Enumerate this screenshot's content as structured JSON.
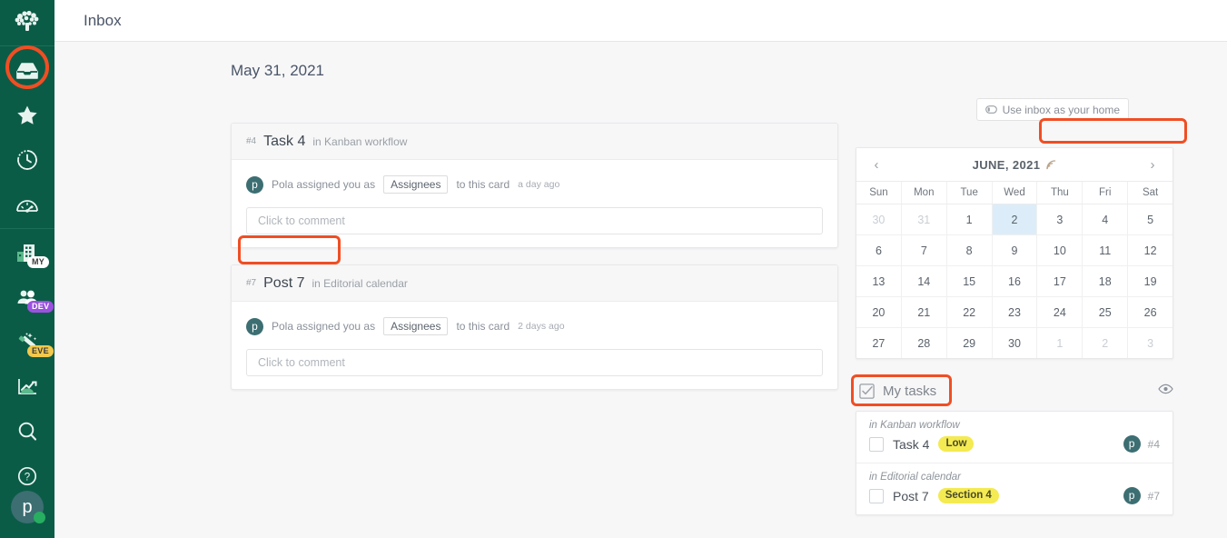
{
  "colors": {
    "rail_bg": "#0b5c47",
    "accent_annotation": "#f04e23",
    "avatar_bg": "#3c6e72",
    "today_highlight": "#dcedf9",
    "tag_yellow": "#f4ea52",
    "badge_dev": "#9b51e0",
    "badge_eve": "#f2c94c",
    "online_dot": "#27ae60"
  },
  "rail": {
    "logo_icon": "tree-logo-icon",
    "items": [
      {
        "icon": "inbox-icon",
        "name": "inbox",
        "badge": ""
      },
      {
        "icon": "star-icon",
        "name": "favorites",
        "badge": ""
      },
      {
        "icon": "clock-icon",
        "name": "recent",
        "badge": ""
      },
      {
        "icon": "gauge-icon",
        "name": "dashboard",
        "badge": ""
      },
      {
        "icon": "building-icon",
        "name": "company",
        "badge": "MY"
      },
      {
        "icon": "people-icon",
        "name": "team",
        "badge": "DEV"
      },
      {
        "icon": "magic-wand-icon",
        "name": "automation",
        "badge": "EVE"
      },
      {
        "icon": "chart-up-icon",
        "name": "reports",
        "badge": ""
      },
      {
        "icon": "search-icon",
        "name": "search",
        "badge": ""
      },
      {
        "icon": "help-icon",
        "name": "help",
        "badge": ""
      }
    ],
    "avatar_initial": "p"
  },
  "topbar": {
    "title": "Inbox"
  },
  "page": {
    "date": "May 31, 2021",
    "inbox_home": {
      "label": "Use inbox as your home",
      "icon": "toggle-icon"
    }
  },
  "cards": [
    {
      "num": "#4",
      "title": "Task 4",
      "where": "in Kanban workflow",
      "activity": {
        "avatar": "p",
        "text_before": "Pola assigned you as",
        "chip": "Assignees",
        "text_after": "to this card",
        "time": "a day ago"
      },
      "comment_placeholder": "Click to comment"
    },
    {
      "num": "#7",
      "title": "Post 7",
      "where": "in Editorial calendar",
      "activity": {
        "avatar": "p",
        "text_before": "Pola assigned you as",
        "chip": "Assignees",
        "text_after": "to this card",
        "time": "2 days ago"
      },
      "comment_placeholder": "Click to comment"
    }
  ],
  "calendar": {
    "title": "JUNE, 2021",
    "feed_icon": "rss-icon",
    "prev_icon": "chevron-left-icon",
    "next_icon": "chevron-right-icon",
    "dow": [
      "Sun",
      "Mon",
      "Tue",
      "Wed",
      "Thu",
      "Fri",
      "Sat"
    ],
    "weeks": [
      [
        {
          "d": "30",
          "muted": true,
          "today": false
        },
        {
          "d": "31",
          "muted": true,
          "today": false
        },
        {
          "d": "1",
          "muted": false,
          "today": false
        },
        {
          "d": "2",
          "muted": false,
          "today": true
        },
        {
          "d": "3",
          "muted": false,
          "today": false
        },
        {
          "d": "4",
          "muted": false,
          "today": false
        },
        {
          "d": "5",
          "muted": false,
          "today": false
        }
      ],
      [
        {
          "d": "6",
          "muted": false,
          "today": false
        },
        {
          "d": "7",
          "muted": false,
          "today": false
        },
        {
          "d": "8",
          "muted": false,
          "today": false
        },
        {
          "d": "9",
          "muted": false,
          "today": false
        },
        {
          "d": "10",
          "muted": false,
          "today": false
        },
        {
          "d": "11",
          "muted": false,
          "today": false
        },
        {
          "d": "12",
          "muted": false,
          "today": false
        }
      ],
      [
        {
          "d": "13",
          "muted": false,
          "today": false
        },
        {
          "d": "14",
          "muted": false,
          "today": false
        },
        {
          "d": "15",
          "muted": false,
          "today": false
        },
        {
          "d": "16",
          "muted": false,
          "today": false
        },
        {
          "d": "17",
          "muted": false,
          "today": false
        },
        {
          "d": "18",
          "muted": false,
          "today": false
        },
        {
          "d": "19",
          "muted": false,
          "today": false
        }
      ],
      [
        {
          "d": "20",
          "muted": false,
          "today": false
        },
        {
          "d": "21",
          "muted": false,
          "today": false
        },
        {
          "d": "22",
          "muted": false,
          "today": false
        },
        {
          "d": "23",
          "muted": false,
          "today": false
        },
        {
          "d": "24",
          "muted": false,
          "today": false
        },
        {
          "d": "25",
          "muted": false,
          "today": false
        },
        {
          "d": "26",
          "muted": false,
          "today": false
        }
      ],
      [
        {
          "d": "27",
          "muted": false,
          "today": false
        },
        {
          "d": "28",
          "muted": false,
          "today": false
        },
        {
          "d": "29",
          "muted": false,
          "today": false
        },
        {
          "d": "30",
          "muted": false,
          "today": false
        },
        {
          "d": "1",
          "muted": true,
          "today": false
        },
        {
          "d": "2",
          "muted": true,
          "today": false
        },
        {
          "d": "3",
          "muted": true,
          "today": false
        }
      ]
    ]
  },
  "my_tasks": {
    "title": "My tasks",
    "title_icon": "checkbox-checked-icon",
    "eye_icon": "eye-icon",
    "groups": [
      {
        "label": "in Kanban workflow",
        "rows": [
          {
            "name": "Task 4",
            "tag": "Low",
            "avatar": "p",
            "num": "#4"
          }
        ]
      },
      {
        "label": "in Editorial calendar",
        "rows": [
          {
            "name": "Post 7",
            "tag": "Section 4",
            "avatar": "p",
            "num": "#7"
          }
        ]
      }
    ]
  },
  "annotations": [
    {
      "name": "inbox-rail-highlight",
      "shape": "circle"
    },
    {
      "name": "inbox-home-highlight",
      "shape": "rect"
    },
    {
      "name": "comment-box-highlight",
      "shape": "rect"
    },
    {
      "name": "my-tasks-highlight",
      "shape": "rect"
    }
  ]
}
